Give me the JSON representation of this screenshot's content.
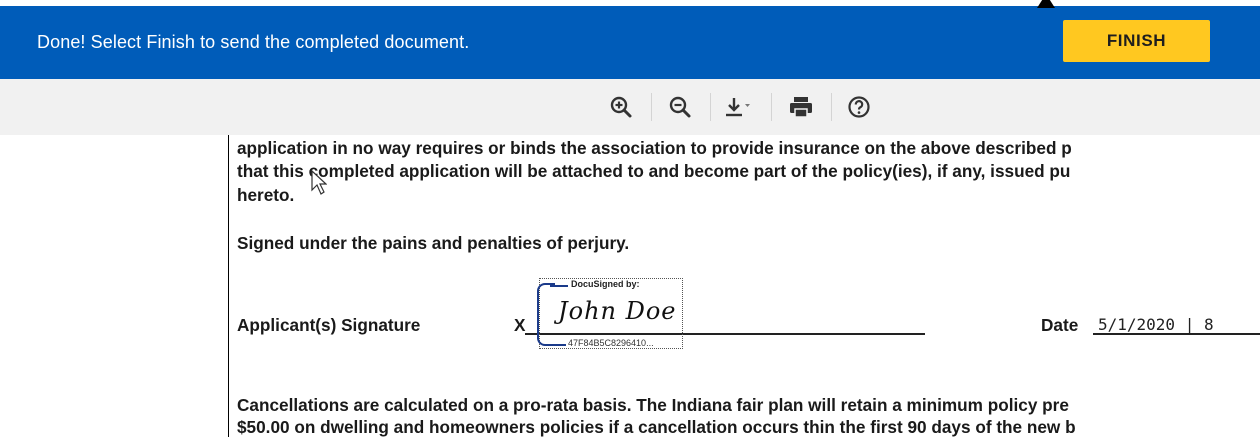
{
  "banner": {
    "message": "Done! Select Finish to send the completed document.",
    "finish_label": "FINISH",
    "background_color": "#005cb9",
    "button_color": "#ffc820"
  },
  "toolbar": {
    "icons": [
      "zoom-in-icon",
      "zoom-out-icon",
      "download-icon",
      "print-icon",
      "help-icon"
    ]
  },
  "document": {
    "lines": [
      "application in no way requires or binds the association to provide insurance on the above described p",
      "that this completed application will be attached to and become part of the policy(ies), if any, issued pu",
      "hereto."
    ],
    "perjury_statement": "Signed under the pains and penalties of perjury.",
    "signature_label": "Applicant(s) Signature",
    "signature_x": "X",
    "docusigned_by": "DocuSigned by:",
    "signature_text": "John Doe",
    "envelope_id": "47F84B5C8296410...",
    "date_label": "Date",
    "date_value": "5/1/2020 | 8",
    "cancellation_lines": [
      "Cancellations are calculated on a pro-rata basis. The Indiana fair plan will retain a minimum policy pre",
      "$50.00 on dwelling and homeowners policies if a cancellation occurs thin the first 90 days of the new b"
    ]
  }
}
